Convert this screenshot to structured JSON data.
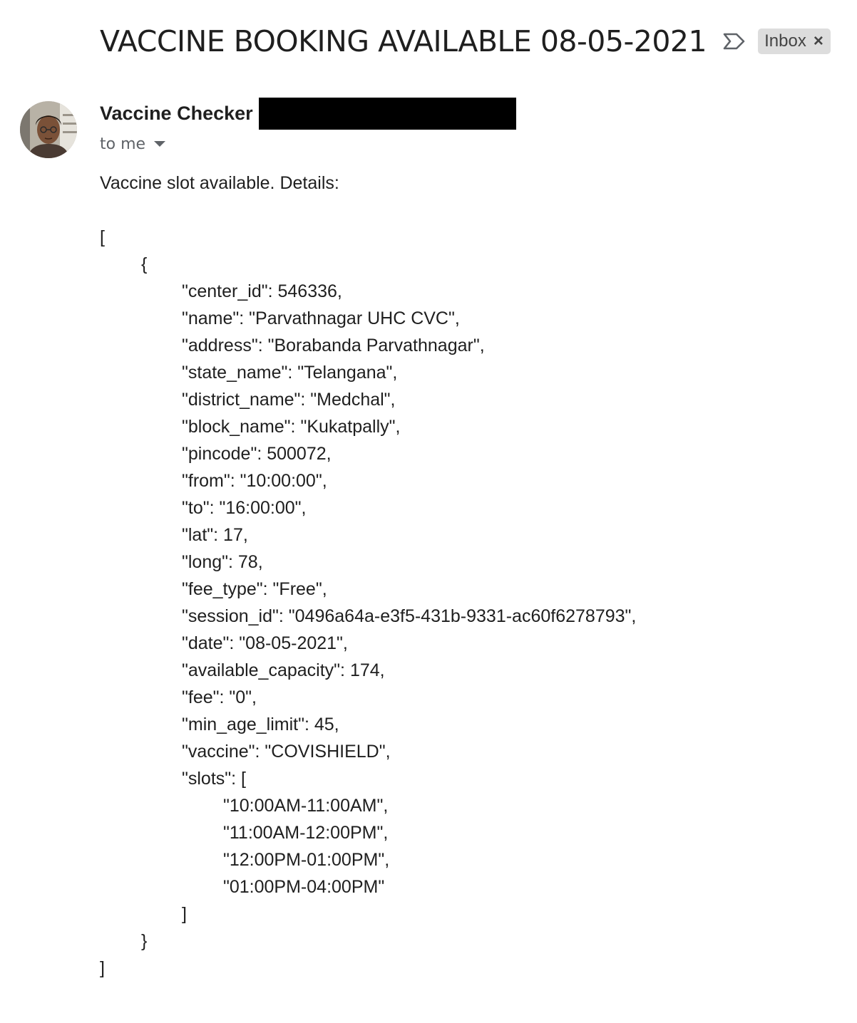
{
  "email": {
    "subject": "VACCINE BOOKING AVAILABLE 08-05-2021",
    "label": "Inbox",
    "label_close": "×",
    "sender_name": "Vaccine Checker",
    "recipient": "to me",
    "intro": "Vaccine slot available. Details:"
  },
  "icons": {
    "importance": "importance-marker-icon",
    "close": "close-icon",
    "caret": "caret-down-icon"
  },
  "json_body": {
    "lines": [
      "[",
      "{",
      "\"center_id\": 546336,",
      "\"name\": \"Parvathnagar UHC CVC\",",
      "\"address\": \"Borabanda Parvathnagar\",",
      "\"state_name\": \"Telangana\",",
      "\"district_name\": \"Medchal\",",
      "\"block_name\": \"Kukatpally\",",
      "\"pincode\": 500072,",
      "\"from\": \"10:00:00\",",
      "\"to\": \"16:00:00\",",
      "\"lat\": 17,",
      "\"long\": 78,",
      "\"fee_type\": \"Free\",",
      "\"session_id\": \"0496a64a-e3f5-431b-9331-ac60f6278793\",",
      "\"date\": \"08-05-2021\",",
      "\"available_capacity\": 174,",
      "\"fee\": \"0\",",
      "\"min_age_limit\": 45,",
      "\"vaccine\": \"COVISHIELD\",",
      "\"slots\": [",
      "\"10:00AM-11:00AM\",",
      "\"11:00AM-12:00PM\",",
      "\"12:00PM-01:00PM\",",
      "\"01:00PM-04:00PM\"",
      "]",
      "}",
      "]"
    ]
  }
}
